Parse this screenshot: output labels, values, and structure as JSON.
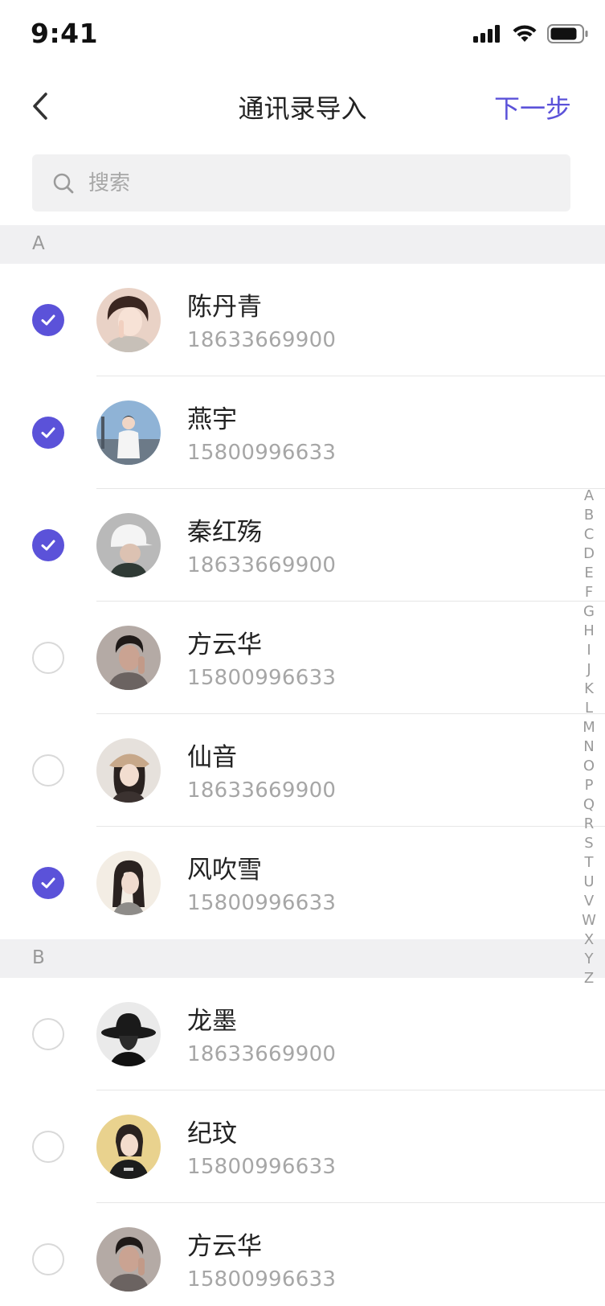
{
  "status_bar": {
    "time": "9:41"
  },
  "nav": {
    "title": "通讯录导入",
    "next_label": "下一步"
  },
  "search": {
    "placeholder": "搜索"
  },
  "sections": [
    {
      "letter": "A"
    },
    {
      "letter": "B"
    }
  ],
  "contacts": [
    {
      "name": "陈丹青",
      "phone": "18633669900",
      "checked": true
    },
    {
      "name": "燕宇",
      "phone": "15800996633",
      "checked": true
    },
    {
      "name": "秦红殇",
      "phone": "18633669900",
      "checked": true
    },
    {
      "name": "方云华",
      "phone": "15800996633",
      "checked": false
    },
    {
      "name": "仙音",
      "phone": "18633669900",
      "checked": false
    },
    {
      "name": "风吹雪",
      "phone": "15800996633",
      "checked": true
    },
    {
      "name": "龙墨",
      "phone": "18633669900",
      "checked": false
    },
    {
      "name": "纪玟",
      "phone": "15800996633",
      "checked": false
    },
    {
      "name": "方云华",
      "phone": "15800996633",
      "checked": false
    }
  ],
  "alphabet": [
    "A",
    "B",
    "C",
    "D",
    "E",
    "F",
    "G",
    "H",
    "I",
    "J",
    "K",
    "L",
    "M",
    "N",
    "O",
    "P",
    "Q",
    "R",
    "S",
    "T",
    "U",
    "V",
    "W",
    "X",
    "Y",
    "Z"
  ],
  "colors": {
    "accent": "#5b52d9",
    "section_bg": "#f0f0f2",
    "search_bg": "#f1f1f2"
  }
}
